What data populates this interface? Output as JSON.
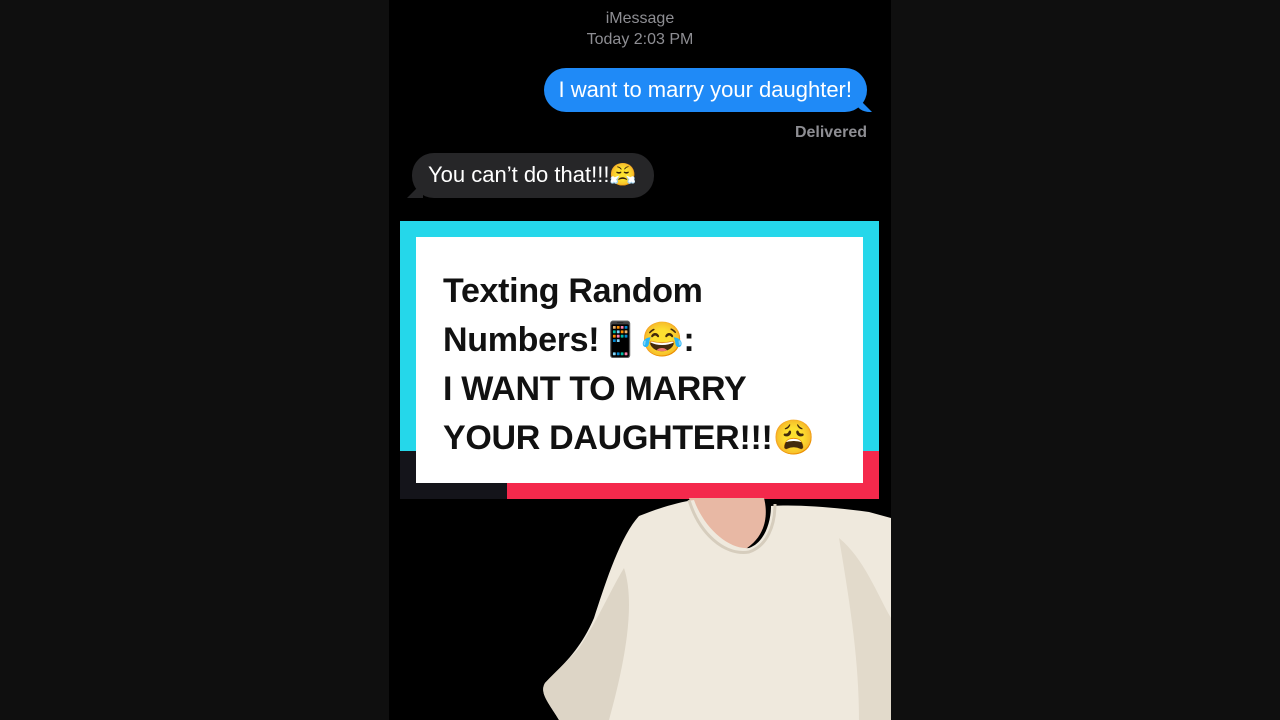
{
  "conversation": {
    "service": "iMessage",
    "timestamp": "Today 2:03 PM",
    "outgoing_message": "I want to marry your daughter!",
    "delivery_status": "Delivered",
    "incoming_message": "You can’t do that!!!😤"
  },
  "overlay_card": {
    "line1": "Texting Random",
    "line2": "Numbers!📱😂:",
    "line3": "I WANT TO MARRY",
    "line4": "YOUR DAUGHTER!!!😩",
    "colors": {
      "frame": "#25d7ea",
      "accent_red": "#f4294c",
      "accent_dark": "#14141a"
    }
  },
  "colors": {
    "outgoing_bubble": "#1f8af7",
    "incoming_bubble": "#262628",
    "background": "#000000"
  }
}
